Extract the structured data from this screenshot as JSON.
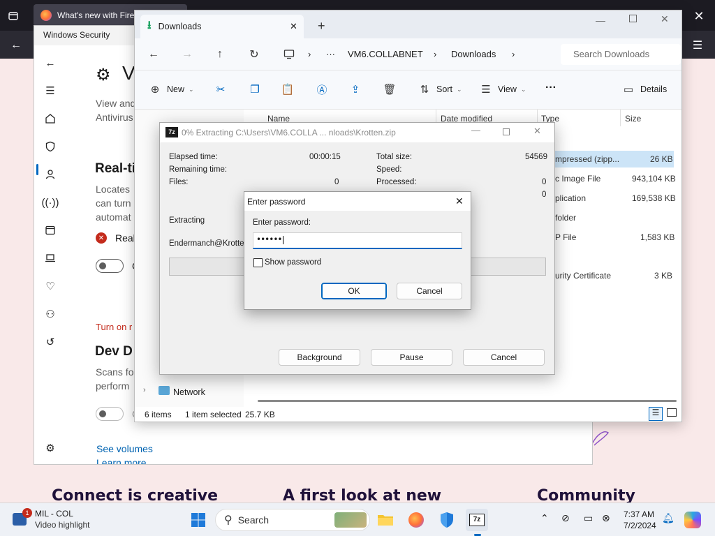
{
  "firefox": {
    "tab_title": "What's new with Firef",
    "page_headings": [
      "Connect is creative",
      "A first look at new",
      "Community"
    ]
  },
  "windows_security": {
    "title": "Windows Security",
    "page_title_initial": "V",
    "intro_text": [
      "View and",
      "Antivirus"
    ],
    "realtime_heading": "Real-ti",
    "realtime_text": [
      "Locates",
      "can turn",
      "automat"
    ],
    "realtime_status": "Real",
    "toggle_label_1": "C",
    "turn_on_link": "Turn on r",
    "dev_heading": "Dev D",
    "dev_text": [
      "Scans fo",
      "perform"
    ],
    "toggle_label_2": "C",
    "see_volumes": "See volumes",
    "learn_more": "Learn more"
  },
  "explorer": {
    "tab_title": "Downloads",
    "breadcrumbs": [
      "VM6.COLLABNET",
      "Downloads"
    ],
    "search_placeholder": "Search Downloads",
    "commands": {
      "new": "New",
      "sort": "Sort",
      "view": "View",
      "details": "Details"
    },
    "columns": [
      "Name",
      "Date modified",
      "Type",
      "Size"
    ],
    "rows": [
      {
        "type": "mpressed (zipp...",
        "size": "26 KB",
        "selected": true
      },
      {
        "type": "c Image File",
        "size": "943,104 KB"
      },
      {
        "type": "plication",
        "size": "169,538 KB"
      },
      {
        "type": "folder",
        "size": ""
      },
      {
        "type": "P File",
        "size": "1,583 KB"
      },
      {
        "type": "urity Certificate",
        "size": "3 KB"
      }
    ],
    "nav_network": "Network",
    "status_items": "6 items",
    "status_selected": "1 item selected",
    "status_size": "25.7 KB"
  },
  "zip_progress": {
    "title": "0% Extracting C:\\Users\\VM6.COLLA ... nloads\\Krotten.zip",
    "elapsed_label": "Elapsed time:",
    "elapsed_value": "00:00:15",
    "remaining_label": "Remaining time:",
    "files_label": "Files:",
    "files_value": "0",
    "total_size_label": "Total size:",
    "total_size_value": "54569",
    "speed_label": "Speed:",
    "processed_label": "Processed:",
    "processed_value": "0",
    "extra_value": "0",
    "extracting_label": "Extracting",
    "current_file": "Endermanch@Krotten.",
    "progress": 0,
    "btn_background": "Background",
    "btn_pause": "Pause",
    "btn_cancel": "Cancel"
  },
  "password_dialog": {
    "title": "Enter password",
    "field_label": "Enter password:",
    "password_masked": "••••••",
    "show_password": "Show password",
    "ok": "OK",
    "cancel": "Cancel"
  },
  "taskbar": {
    "notification_badge": "1",
    "widget_title": "MIL - COL",
    "widget_subtitle": "Video highlight",
    "search": "Search",
    "time": "7:37 AM",
    "date": "7/2/2024"
  }
}
